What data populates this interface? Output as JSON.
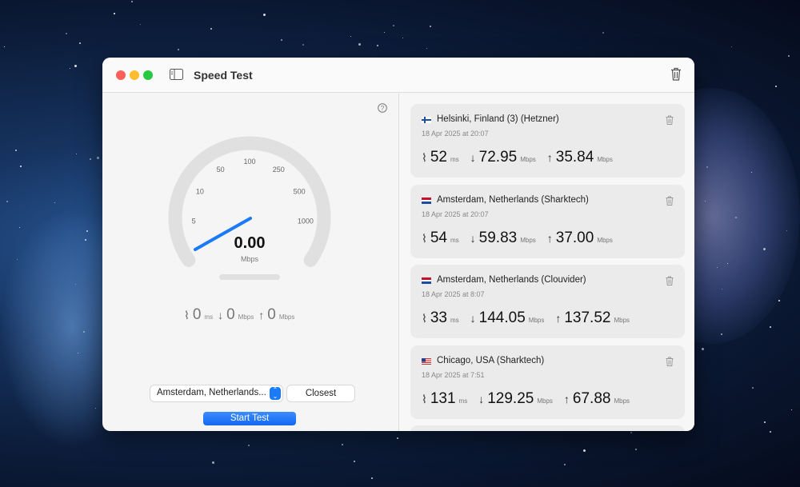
{
  "window": {
    "title": "Speed Test"
  },
  "gauge": {
    "value": "0.00",
    "unit": "Mbps",
    "ticks": [
      "5",
      "10",
      "50",
      "100",
      "250",
      "500",
      "1000"
    ],
    "needle_fraction": 0.0
  },
  "current": {
    "ping": "0",
    "ping_unit": "ms",
    "download": "0",
    "download_unit": "Mbps",
    "upload": "0",
    "upload_unit": "Mbps"
  },
  "server_select": {
    "value": "Amsterdam, Netherlands..."
  },
  "closest_label": "Closest",
  "start_label": "Start Test",
  "accent": "#1a7af7",
  "results": [
    {
      "location": "Helsinki, Finland (3) (Hetzner)",
      "flag": "FI",
      "date": "18 Apr 2025 at 20:07",
      "ping": "52",
      "download": "72.95",
      "upload": "35.84",
      "ping_unit": "ms",
      "speed_unit": "Mbps"
    },
    {
      "location": "Amsterdam, Netherlands (Sharktech)",
      "flag": "NL",
      "date": "18 Apr 2025 at 20:07",
      "ping": "54",
      "download": "59.83",
      "upload": "37.00",
      "ping_unit": "ms",
      "speed_unit": "Mbps"
    },
    {
      "location": "Amsterdam, Netherlands (Clouvider)",
      "flag": "NL",
      "date": "18 Apr 2025 at 8:07",
      "ping": "33",
      "download": "144.05",
      "upload": "137.52",
      "ping_unit": "ms",
      "speed_unit": "Mbps"
    },
    {
      "location": "Chicago, USA (Sharktech)",
      "flag": "US",
      "date": "18 Apr 2025 at 7:51",
      "ping": "131",
      "download": "129.25",
      "upload": "67.88",
      "ping_unit": "ms",
      "speed_unit": "Mbps"
    }
  ]
}
